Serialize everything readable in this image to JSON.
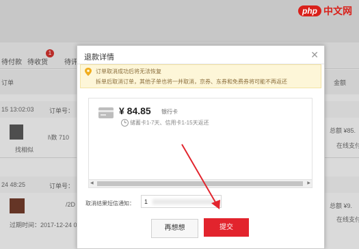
{
  "watermark": {
    "logo": "php",
    "text": "中文网"
  },
  "background": {
    "tabs": [
      "待付款",
      "待收货",
      "待评价"
    ],
    "badge": "1",
    "order_col": "订单",
    "amount_col": "金额",
    "row1_time": "15 13:02:03",
    "row1_orderno": "订单号：",
    "row1_product": "l\\数 710",
    "row1_link": "找相似",
    "row1_total": "总额 ¥85.",
    "row1_pay": "在线支付",
    "row2_time": "24 48:25",
    "row2_orderno": "订单号：",
    "row2_product": "/2D",
    "row2_total": "总额 ¥9.",
    "row2_pay": "在线支付",
    "row2_expire": "过期时间：2017-12-24 0"
  },
  "dialog": {
    "title": "退款详情",
    "close_icon": "close-icon",
    "notice_line1": "订单取消成功后将无法恢复",
    "notice_line2": "拆单后取消订单，其他子单也将一并取消，京券、东券和免费券将可能不再返还",
    "amount": "¥ 84.85",
    "amount_type": "银行卡",
    "arrive_time": "储蓄卡1-7天、信用卡1-15天返还",
    "sms_label": "取消结果短信通知：",
    "sms_value": "1",
    "cancel_label": "再想想",
    "submit_label": "提交"
  },
  "colors": {
    "accent": "#e2242d",
    "notice_bg": "#fdf6d8",
    "watermark": "#d9211b"
  }
}
